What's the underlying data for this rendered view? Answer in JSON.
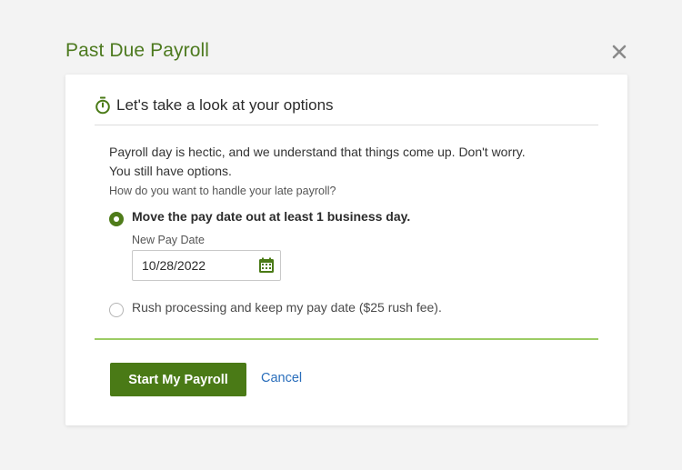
{
  "dialog": {
    "title": "Past Due Payroll",
    "close_icon": "close-icon"
  },
  "section": {
    "icon": "stopwatch-icon",
    "heading": "Let's take a look at your options"
  },
  "intro": {
    "line1": "Payroll day is hectic, and we understand that things come up. Don't worry.",
    "line2": "You still have options."
  },
  "question": "How do you want to handle your late payroll?",
  "options": [
    {
      "label": "Move the pay date out at least 1 business day.",
      "selected": true
    },
    {
      "label": "Rush processing and keep my pay date ($25 rush fee).",
      "selected": false
    }
  ],
  "pay_date": {
    "label": "New Pay Date",
    "value": "10/28/2022",
    "icon": "calendar-icon"
  },
  "actions": {
    "primary_label": "Start My Payroll",
    "cancel_label": "Cancel"
  },
  "colors": {
    "brand_green": "#4a7a16",
    "title_green": "#4d7a1f",
    "divider_green": "#9ccc65",
    "link_blue": "#2a6ebb"
  }
}
